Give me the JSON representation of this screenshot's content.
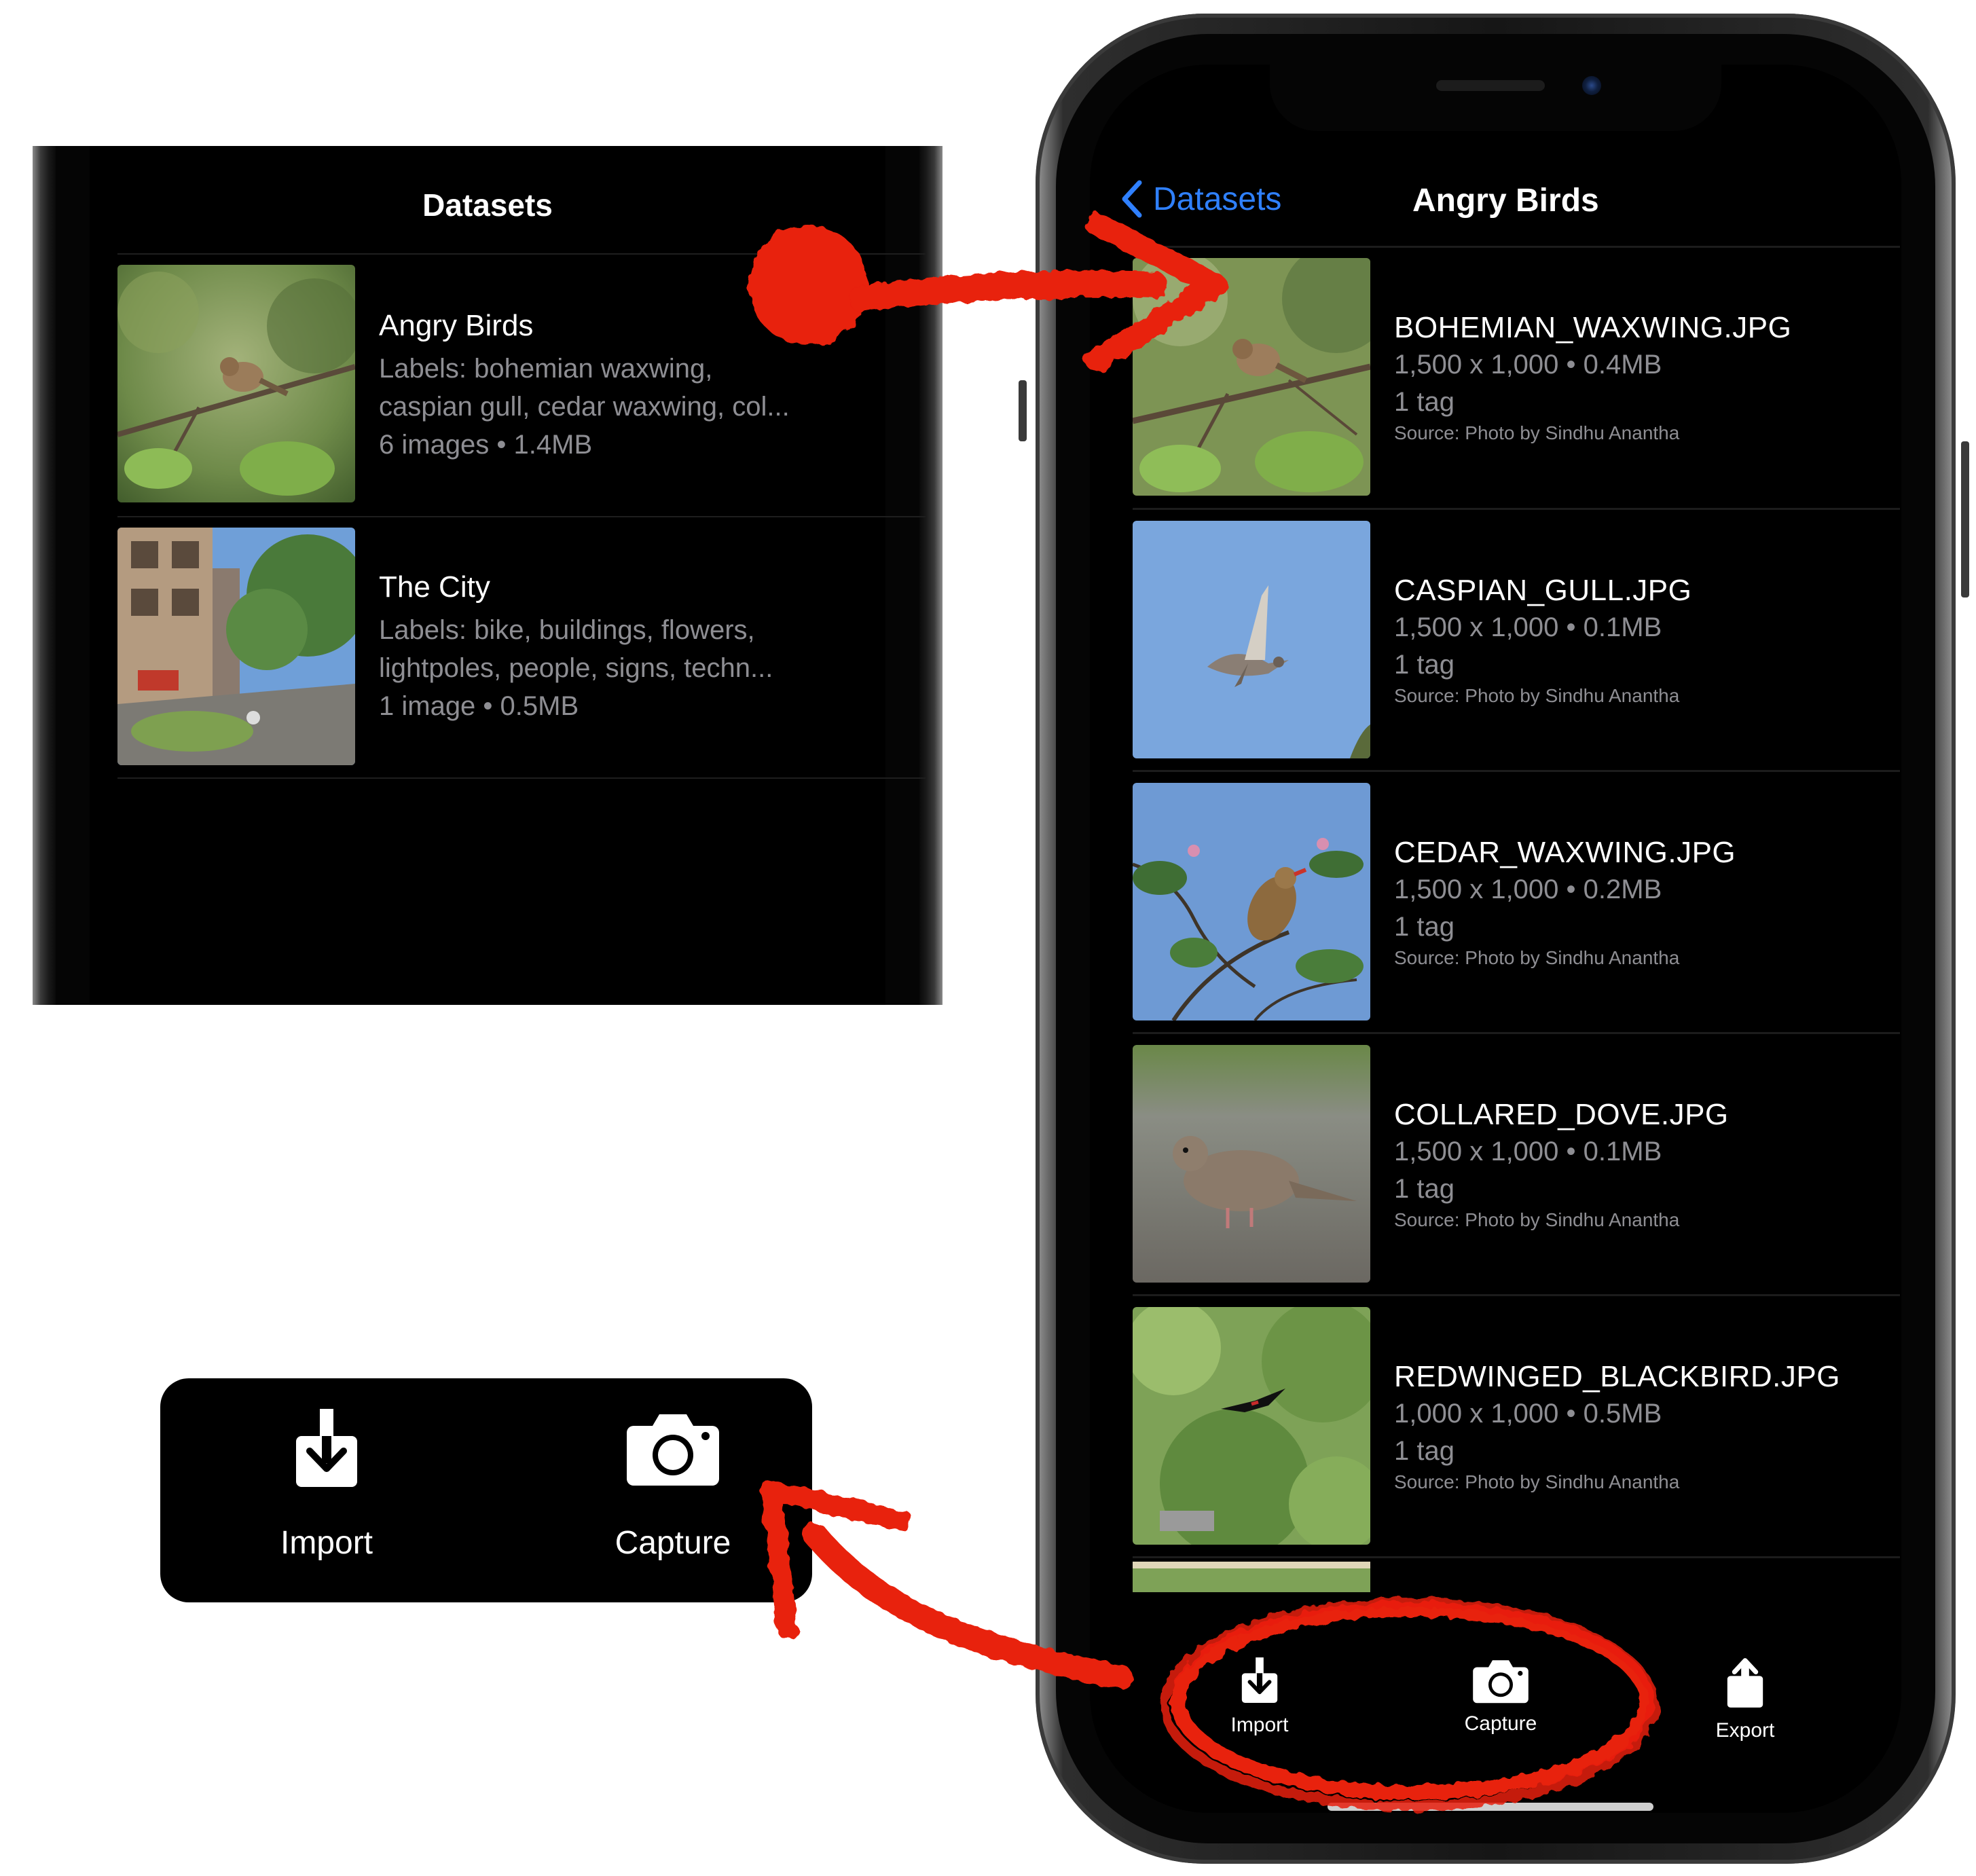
{
  "left_screen": {
    "title": "Datasets",
    "datasets": [
      {
        "name": "Angry Birds",
        "labels_line1": "Labels: bohemian waxwing,",
        "labels_line2": "caspian gull, cedar waxwing, col...",
        "meta": "6 images • 1.4MB"
      },
      {
        "name": "The City",
        "labels_line1": "Labels: bike, buildings, flowers,",
        "labels_line2": "lightpoles, people, signs, techn...",
        "meta": "1 image • 0.5MB"
      }
    ]
  },
  "toolbar_callout": {
    "import_label": "Import",
    "capture_label": "Capture"
  },
  "right_screen": {
    "back_label": "Datasets",
    "title": "Angry Birds",
    "images": [
      {
        "filename": "BOHEMIAN_WAXWING.JPG",
        "dims": "1,500 x 1,000 • 0.4MB",
        "tags": "1 tag",
        "source": "Source: Photo by Sindhu Anantha"
      },
      {
        "filename": "CASPIAN_GULL.JPG",
        "dims": "1,500 x 1,000 • 0.1MB",
        "tags": "1 tag",
        "source": "Source: Photo by Sindhu Anantha"
      },
      {
        "filename": "CEDAR_WAXWING.JPG",
        "dims": "1,500 x 1,000 • 0.2MB",
        "tags": "1 tag",
        "source": "Source: Photo by Sindhu Anantha"
      },
      {
        "filename": "COLLARED_DOVE.JPG",
        "dims": "1,500 x 1,000 • 0.1MB",
        "tags": "1 tag",
        "source": "Source: Photo by Sindhu Anantha"
      },
      {
        "filename": "REDWINGED_BLACKBIRD.JPG",
        "dims": "1,000 x 1,000 • 0.5MB",
        "tags": "1 tag",
        "source": "Source: Photo by Sindhu Anantha"
      }
    ],
    "toolbar": {
      "import_label": "Import",
      "capture_label": "Capture",
      "export_label": "Export"
    }
  },
  "colors": {
    "accent_blue": "#2f80ff",
    "annotation_red": "#e8200c",
    "secondary_text": "#8e8e93"
  }
}
